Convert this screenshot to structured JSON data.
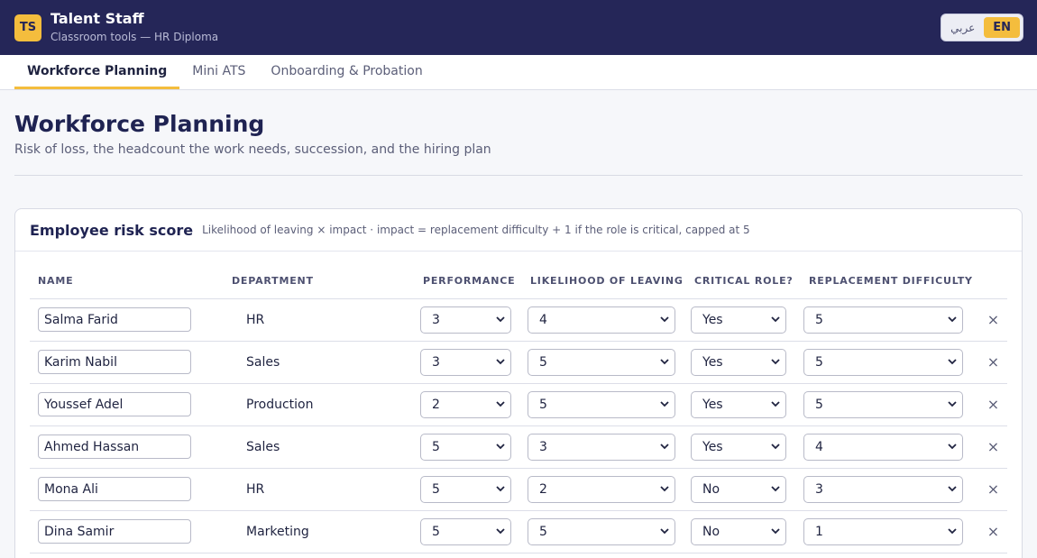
{
  "app": {
    "logo": "TS",
    "name": "Talent Staff",
    "subtitle": "Classroom tools — HR Diploma",
    "lang_ar": "عربي",
    "lang_en": "EN"
  },
  "tabs": [
    {
      "label": "Workforce Planning",
      "active": true
    },
    {
      "label": "Mini ATS",
      "active": false
    },
    {
      "label": "Onboarding & Probation",
      "active": false
    }
  ],
  "page": {
    "title": "Workforce Planning",
    "subtitle": "Risk of loss, the headcount the work needs, succession, and the hiring plan"
  },
  "risk_card": {
    "title": "Employee risk score",
    "note": "Likelihood of leaving × impact · impact = replacement difficulty + 1 if the role is critical, capped at 5",
    "columns": {
      "name": "NAME",
      "department": "DEPARTMENT",
      "performance": "PERFORMANCE",
      "likelihood": "LIKELIHOOD OF LEAVING",
      "critical": "CRITICAL ROLE?",
      "replacement": "REPLACEMENT DIFFICULTY"
    },
    "rows": [
      {
        "name": "Salma Farid",
        "department": "HR",
        "performance": "3",
        "likelihood": "4",
        "critical": "Yes",
        "replacement": "5",
        "remove": "×"
      },
      {
        "name": "Karim Nabil",
        "department": "Sales",
        "performance": "3",
        "likelihood": "5",
        "critical": "Yes",
        "replacement": "5",
        "remove": "×"
      },
      {
        "name": "Youssef Adel",
        "department": "Production",
        "performance": "2",
        "likelihood": "5",
        "critical": "Yes",
        "replacement": "5",
        "remove": "×"
      },
      {
        "name": "Ahmed Hassan",
        "department": "Sales",
        "performance": "5",
        "likelihood": "3",
        "critical": "Yes",
        "replacement": "4",
        "remove": "×"
      },
      {
        "name": "Mona Ali",
        "department": "HR",
        "performance": "5",
        "likelihood": "2",
        "critical": "No",
        "replacement": "3",
        "remove": "×"
      },
      {
        "name": "Dina Samir",
        "department": "Marketing",
        "performance": "5",
        "likelihood": "5",
        "critical": "No",
        "replacement": "1",
        "remove": "×"
      }
    ]
  },
  "colors": {
    "header_bg": "#252658",
    "accent": "#f4bd3d"
  }
}
